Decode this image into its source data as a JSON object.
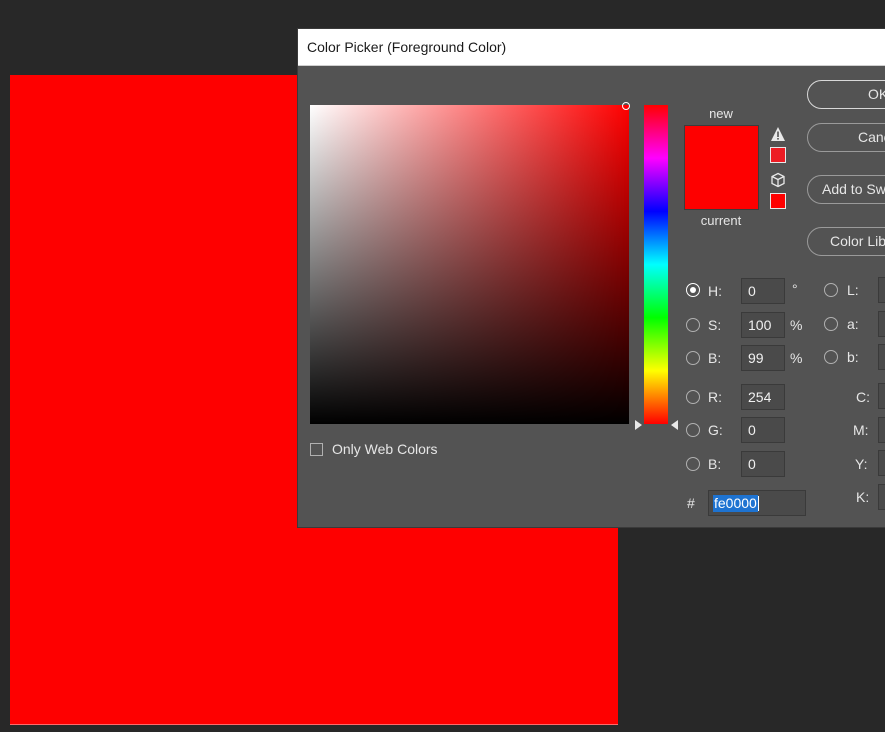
{
  "dialog": {
    "title": "Color Picker (Foreground Color)"
  },
  "swatch": {
    "new_label": "new",
    "current_label": "current",
    "new_color": "#fe0000",
    "current_color": "#fe0000",
    "out_of_gamut_icon": "warning-triangle-icon",
    "out_of_gamut_color": "#ed1c24",
    "web_safe_icon": "cube-icon",
    "web_safe_color": "#ff0000"
  },
  "buttons": {
    "ok": "OK",
    "cancel": "Cancel",
    "add_to_swatches": "Add to Swatches",
    "color_libraries": "Color Libraries"
  },
  "options": {
    "only_web_colors": "Only Web Colors"
  },
  "hsb": {
    "h_label": "H:",
    "h_value": "0",
    "h_unit": "°",
    "s_label": "S:",
    "s_value": "100",
    "s_unit": "%",
    "b_label": "B:",
    "b_value": "99",
    "b_unit": "%"
  },
  "rgb": {
    "r_label": "R:",
    "r_value": "254",
    "g_label": "G:",
    "g_value": "0",
    "b_label": "B:",
    "b_value": "0"
  },
  "lab": {
    "l_label": "L:",
    "a_label": "a:",
    "b_label": "b:"
  },
  "cmyk": {
    "c_label": "C:",
    "m_label": "M:",
    "y_label": "Y:",
    "k_label": "K:"
  },
  "hex": {
    "hash": "#",
    "value": "fe0000"
  },
  "colors": {
    "canvas": "#fe0000",
    "dialog_bg": "#535353",
    "workspace_bg": "#282828"
  }
}
